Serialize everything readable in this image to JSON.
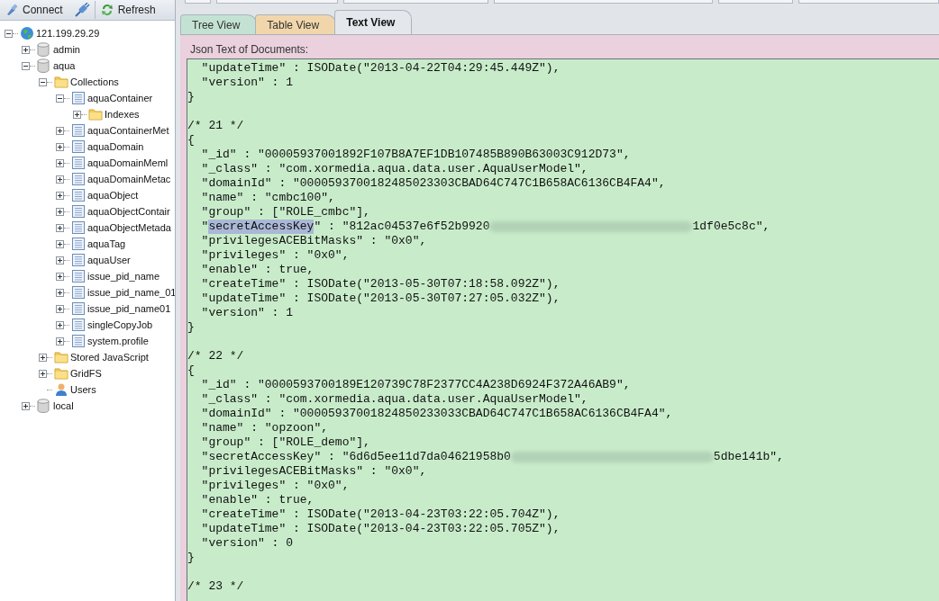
{
  "toolbar": {
    "buttons": [
      {
        "label": "Connect",
        "kind": "connect"
      },
      {
        "label": "Refresh",
        "kind": "refresh"
      }
    ]
  },
  "tree": [
    {
      "label": "121.199.29.29",
      "kind": "server",
      "expanded": true,
      "children": [
        {
          "label": "admin",
          "kind": "database",
          "expanded": false
        },
        {
          "label": "aqua",
          "kind": "database",
          "expanded": true,
          "children": [
            {
              "label": "Collections",
              "kind": "folder",
              "expanded": true,
              "children": [
                {
                  "label": "aquaContainer",
                  "kind": "collection",
                  "expanded": true,
                  "children": [
                    {
                      "label": "Indexes",
                      "kind": "folder",
                      "expanded": false
                    }
                  ]
                },
                {
                  "label": "aquaContainerMet",
                  "kind": "collection",
                  "expanded": false
                },
                {
                  "label": "aquaDomain",
                  "kind": "collection",
                  "expanded": false
                },
                {
                  "label": "aquaDomainMeml",
                  "kind": "collection",
                  "expanded": false
                },
                {
                  "label": "aquaDomainMetac",
                  "kind": "collection",
                  "expanded": false
                },
                {
                  "label": "aquaObject",
                  "kind": "collection",
                  "expanded": false
                },
                {
                  "label": "aquaObjectContair",
                  "kind": "collection",
                  "expanded": false
                },
                {
                  "label": "aquaObjectMetada",
                  "kind": "collection",
                  "expanded": false
                },
                {
                  "label": "aquaTag",
                  "kind": "collection",
                  "expanded": false
                },
                {
                  "label": "aquaUser",
                  "kind": "collection",
                  "expanded": false
                },
                {
                  "label": "issue_pid_name",
                  "kind": "collection",
                  "expanded": false
                },
                {
                  "label": "issue_pid_name_01",
                  "kind": "collection",
                  "expanded": false
                },
                {
                  "label": "issue_pid_name01",
                  "kind": "collection",
                  "expanded": false
                },
                {
                  "label": "singleCopyJob",
                  "kind": "collection",
                  "expanded": false
                },
                {
                  "label": "system.profile",
                  "kind": "collection",
                  "expanded": false
                }
              ]
            },
            {
              "label": "Stored JavaScript",
              "kind": "folder",
              "expanded": false
            },
            {
              "label": "GridFS",
              "kind": "folder",
              "expanded": false
            },
            {
              "label": "Users",
              "kind": "user"
            }
          ]
        },
        {
          "label": "local",
          "kind": "database",
          "expanded": false
        }
      ]
    }
  ],
  "tabs": [
    {
      "label": "Tree View",
      "selected": false,
      "color": "#c3e2d3"
    },
    {
      "label": "Table View",
      "selected": false,
      "color": "#f2d6ab"
    },
    {
      "label": "Text View",
      "selected": true,
      "color": "#e4e7ec"
    }
  ],
  "text_view": {
    "label": "Json Text of Documents:",
    "lines": [
      {
        "kind": "text",
        "text": "  \"updateTime\" : ISODate(\"2013-04-22T04:29:45.449Z\"),"
      },
      {
        "kind": "text",
        "text": "  \"version\" : 1"
      },
      {
        "kind": "text",
        "text": "}"
      },
      {
        "kind": "blank"
      },
      {
        "kind": "text",
        "text": "/* 21 */"
      },
      {
        "kind": "text",
        "text": "{"
      },
      {
        "kind": "text",
        "text": "  \"_id\" : \"00005937001892F107B8A7EF1DB107485B890B63003C912D73\","
      },
      {
        "kind": "text",
        "text": "  \"_class\" : \"com.xormedia.aqua.data.user.AquaUserModel\","
      },
      {
        "kind": "text",
        "text": "  \"domainId\" : \"000059370018248502330​3CBAD64C747C1B658AC6136CB4FA4\","
      },
      {
        "kind": "text",
        "text": "  \"name\" : \"cmbc100\","
      },
      {
        "kind": "text",
        "text": "  \"group\" : [\"ROLE_cmbc\"],"
      },
      {
        "kind": "segments",
        "segments": [
          {
            "kind": "text",
            "text": "  \""
          },
          {
            "kind": "selected",
            "text": "secretAccessKey"
          },
          {
            "kind": "text",
            "text": "\" : \"812ac04537e6f52b9920"
          },
          {
            "kind": "redacted"
          },
          {
            "kind": "text",
            "text": "1df0e5c8c\","
          }
        ]
      },
      {
        "kind": "text",
        "text": "  \"privilegesACEBitMasks\" : \"0x0\","
      },
      {
        "kind": "text",
        "text": "  \"privileges\" : \"0x0\","
      },
      {
        "kind": "text",
        "text": "  \"enable\" : true,"
      },
      {
        "kind": "text",
        "text": "  \"createTime\" : ISODate(\"2013-05-30T07:18:58.092Z\"),"
      },
      {
        "kind": "text",
        "text": "  \"updateTime\" : ISODate(\"2013-05-30T07:27:05.032Z\"),"
      },
      {
        "kind": "text",
        "text": "  \"version\" : 1"
      },
      {
        "kind": "text",
        "text": "}"
      },
      {
        "kind": "blank"
      },
      {
        "kind": "text",
        "text": "/* 22 */"
      },
      {
        "kind": "text",
        "text": "{"
      },
      {
        "kind": "text",
        "text": "  \"_id\" : \"0000593700189E120739C78F2377CC4A238D6924F372A46AB9\","
      },
      {
        "kind": "text",
        "text": "  \"_class\" : \"com.xormedia.aqua.data.user.AquaUserModel\","
      },
      {
        "kind": "text",
        "text": "  \"domainId\" : \"00005937001824850233033CBAD64C747C1B658AC6136CB4FA4\","
      },
      {
        "kind": "text",
        "text": "  \"name\" : \"opzoon\","
      },
      {
        "kind": "text",
        "text": "  \"group\" : [\"ROLE_demo\"],"
      },
      {
        "kind": "segments",
        "segments": [
          {
            "kind": "text",
            "text": "  \"secretAccessKey\" : \"6d6d5ee11d7da04621958b0"
          },
          {
            "kind": "redacted"
          },
          {
            "kind": "text",
            "text": "5dbe141b\","
          }
        ]
      },
      {
        "kind": "text",
        "text": "  \"privilegesACEBitMasks\" : \"0x0\","
      },
      {
        "kind": "text",
        "text": "  \"privileges\" : \"0x0\","
      },
      {
        "kind": "text",
        "text": "  \"enable\" : true,"
      },
      {
        "kind": "text",
        "text": "  \"createTime\" : ISODate(\"2013-04-23T03:22:05.704Z\"),"
      },
      {
        "kind": "text",
        "text": "  \"updateTime\" : ISODate(\"2013-04-23T03:22:05.705Z\"),"
      },
      {
        "kind": "text",
        "text": "  \"version\" : 0"
      },
      {
        "kind": "text",
        "text": "}"
      },
      {
        "kind": "blank"
      },
      {
        "kind": "text",
        "text": "/* 23 */"
      }
    ]
  }
}
